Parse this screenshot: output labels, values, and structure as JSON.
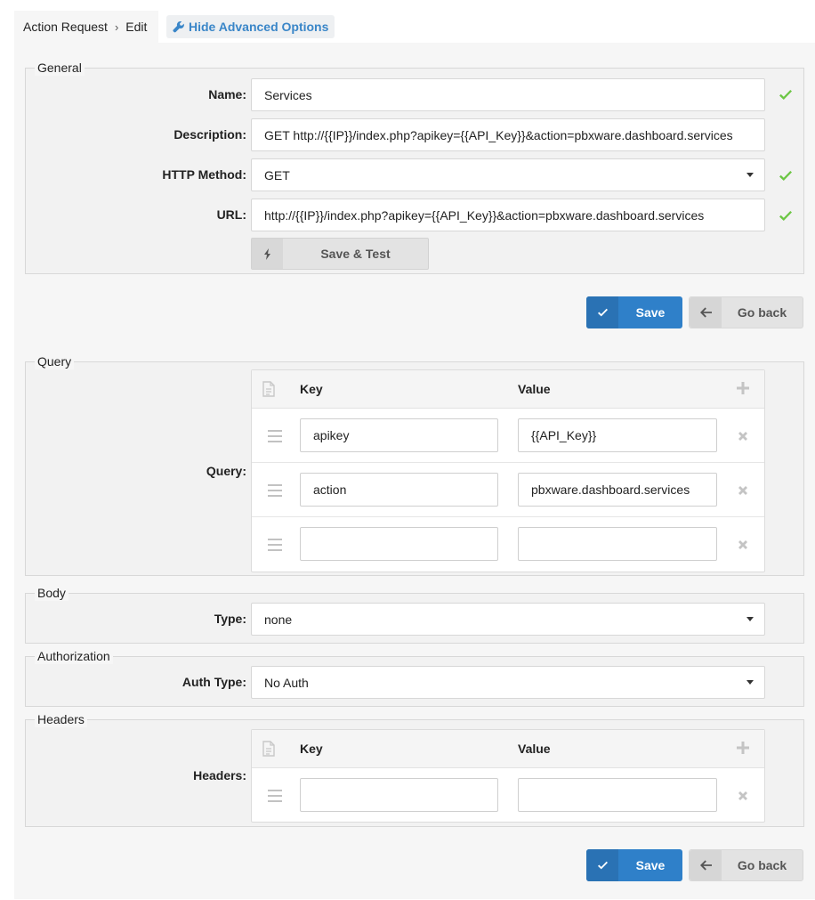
{
  "breadcrumb": {
    "parent": "Action Request",
    "current": "Edit"
  },
  "advanced_toggle": {
    "label": "Hide Advanced Options"
  },
  "general": {
    "legend": "General",
    "name": {
      "label": "Name:",
      "value": "Services"
    },
    "description": {
      "label": "Description:",
      "value": "GET http://{{IP}}/index.php?apikey={{API_Key}}&action=pbxware.dashboard.services"
    },
    "http_method": {
      "label": "HTTP Method:",
      "value": "GET"
    },
    "url": {
      "label": "URL:",
      "value": "http://{{IP}}/index.php?apikey={{API_Key}}&action=pbxware.dashboard.services"
    },
    "save_test_label": "Save & Test"
  },
  "actions": {
    "save_label": "Save",
    "back_label": "Go back"
  },
  "query": {
    "legend": "Query",
    "label": "Query:",
    "key_header": "Key",
    "value_header": "Value",
    "rows": [
      {
        "key": "apikey",
        "value": "{{API_Key}}"
      },
      {
        "key": "action",
        "value": "pbxware.dashboard.services"
      },
      {
        "key": "",
        "value": ""
      }
    ]
  },
  "body": {
    "legend": "Body",
    "label": "Type:",
    "value": "none"
  },
  "authorization": {
    "legend": "Authorization",
    "label": "Auth Type:",
    "value": "No Auth"
  },
  "headers": {
    "legend": "Headers",
    "label": "Headers:",
    "key_header": "Key",
    "value_header": "Value",
    "rows": [
      {
        "key": "",
        "value": ""
      }
    ]
  },
  "colors": {
    "accent": "#2f80c9",
    "valid": "#6cc644",
    "link": "#3a86c8"
  }
}
